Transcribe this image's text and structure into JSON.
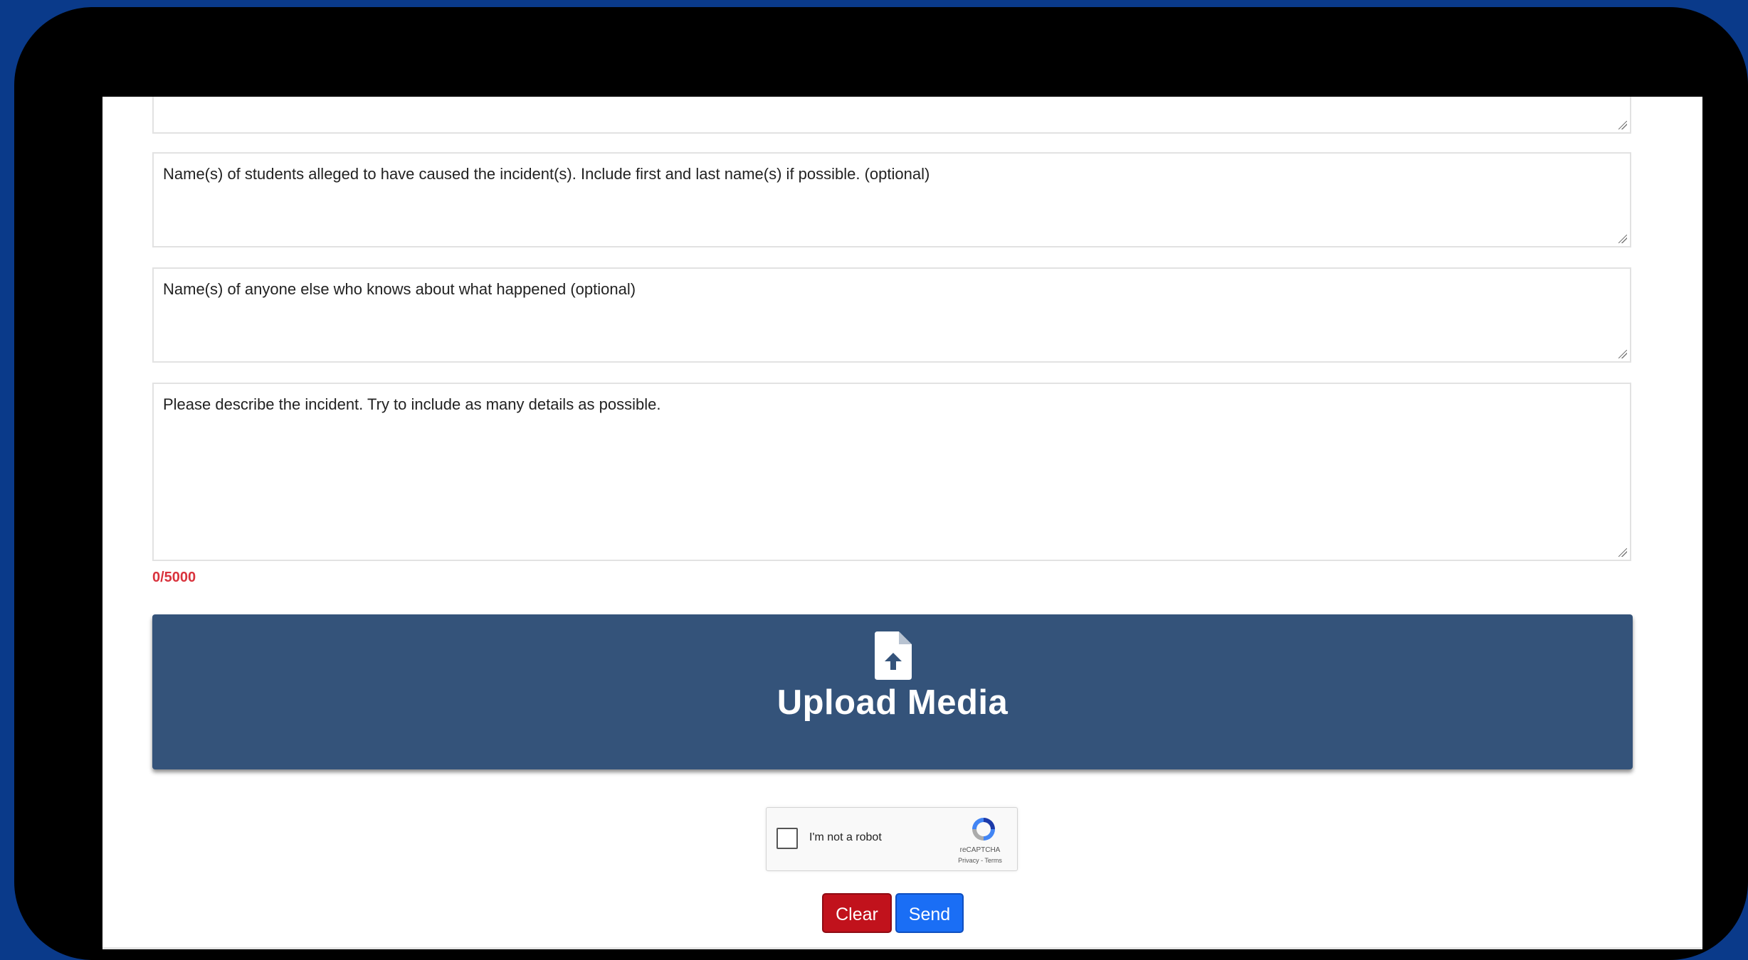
{
  "form": {
    "students_placeholder": "Name(s) of students alleged to have caused the incident(s). Include first and last name(s) if possible. (optional)",
    "witnesses_placeholder": "Name(s) of anyone else who knows about what happened (optional)",
    "description_placeholder": "Please describe the incident. Try to include as many details as possible.",
    "char_counter": "0/5000"
  },
  "upload": {
    "label": "Upload Media",
    "icon": "file-upload-icon",
    "background_color": "#34537a"
  },
  "captcha": {
    "label": "I'm not a robot",
    "brand": "reCAPTCHA",
    "links": "Privacy - Terms"
  },
  "buttons": {
    "clear_label": "Clear",
    "clear_color": "#c1121c",
    "send_label": "Send",
    "send_color": "#1a6ef5"
  }
}
